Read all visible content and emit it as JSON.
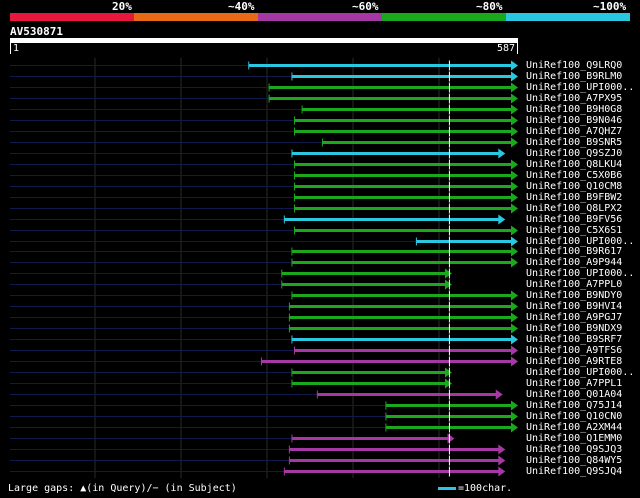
{
  "legend": [
    {
      "label": "",
      "color": "#e8173c"
    },
    {
      "label": "20%",
      "color": "#e86a17"
    },
    {
      "label": "~40%",
      "color": "#a638a6"
    },
    {
      "label": "~60%",
      "color": "#1ca81c"
    },
    {
      "label": "~80%",
      "color": "#29c7e0"
    },
    {
      "label": "~100%",
      "color": ""
    }
  ],
  "query": {
    "id": "AV530871",
    "start": "1",
    "end": "587"
  },
  "hits": [
    {
      "name": "UniRef100_Q9LRQ0",
      "color": "#29c7e0",
      "start": 0.47,
      "end": 1.0
    },
    {
      "name": "UniRef100_B9RLM0",
      "color": "#29c7e0",
      "start": 0.555,
      "end": 1.0
    },
    {
      "name": "UniRef100_UPI000..",
      "color": "#1ca81c",
      "start": 0.51,
      "end": 1.0
    },
    {
      "name": "UniRef100_A7PX95",
      "color": "#1ca81c",
      "start": 0.51,
      "end": 1.0
    },
    {
      "name": "UniRef100_B9H0G8",
      "color": "#1ca81c",
      "start": 0.575,
      "end": 1.0
    },
    {
      "name": "UniRef100_B9N046",
      "color": "#1ca81c",
      "start": 0.56,
      "end": 1.0
    },
    {
      "name": "UniRef100_A7QHZ7",
      "color": "#1ca81c",
      "start": 0.56,
      "end": 1.0
    },
    {
      "name": "UniRef100_B9SNR5",
      "color": "#1ca81c",
      "start": 0.615,
      "end": 1.0
    },
    {
      "name": "UniRef100_Q9SZJ0",
      "color": "#29c7e0",
      "start": 0.555,
      "end": 0.975
    },
    {
      "name": "UniRef100_Q8LKU4",
      "color": "#1ca81c",
      "start": 0.56,
      "end": 1.0
    },
    {
      "name": "UniRef100_C5X0B6",
      "color": "#1ca81c",
      "start": 0.56,
      "end": 1.0
    },
    {
      "name": "UniRef100_Q10CM8",
      "color": "#1ca81c",
      "start": 0.56,
      "end": 1.0
    },
    {
      "name": "UniRef100_B9FBW2",
      "color": "#1ca81c",
      "start": 0.56,
      "end": 1.0
    },
    {
      "name": "UniRef100_Q8LPX2",
      "color": "#1ca81c",
      "start": 0.56,
      "end": 1.0
    },
    {
      "name": "UniRef100_B9FV56",
      "color": "#29c7e0",
      "start": 0.54,
      "end": 0.975
    },
    {
      "name": "UniRef100_C5X6S1",
      "color": "#1ca81c",
      "start": 0.56,
      "end": 1.0
    },
    {
      "name": "UniRef100_UPI000..",
      "color": "#29c7e0",
      "start": 0.8,
      "end": 1.0
    },
    {
      "name": "UniRef100_B9R617",
      "color": "#1ca81c",
      "start": 0.555,
      "end": 1.0
    },
    {
      "name": "UniRef100_A9P944",
      "color": "#1ca81c",
      "start": 0.555,
      "end": 1.0
    },
    {
      "name": "UniRef100_UPI000..",
      "color": "#1ca81c",
      "start": 0.535,
      "end": 0.87
    },
    {
      "name": "UniRef100_A7PPL0",
      "color": "#1ca81c",
      "start": 0.535,
      "end": 0.87
    },
    {
      "name": "UniRef100_B9NDY0",
      "color": "#1ca81c",
      "start": 0.555,
      "end": 1.0
    },
    {
      "name": "UniRef100_B9HVI4",
      "color": "#1ca81c",
      "start": 0.55,
      "end": 1.0
    },
    {
      "name": "UniRef100_A9PGJ7",
      "color": "#1ca81c",
      "start": 0.55,
      "end": 1.0
    },
    {
      "name": "UniRef100_B9NDX9",
      "color": "#1ca81c",
      "start": 0.55,
      "end": 1.0
    },
    {
      "name": "UniRef100_B9SRF7",
      "color": "#29c7e0",
      "start": 0.555,
      "end": 1.0
    },
    {
      "name": "UniRef100_A9TFS6",
      "color": "#a638a6",
      "start": 0.56,
      "end": 1.0
    },
    {
      "name": "UniRef100_A9RTE8",
      "color": "#a638a6",
      "start": 0.495,
      "end": 1.0
    },
    {
      "name": "UniRef100_UPI000..",
      "color": "#1ca81c",
      "start": 0.555,
      "end": 0.87
    },
    {
      "name": "UniRef100_A7PPL1",
      "color": "#1ca81c",
      "start": 0.555,
      "end": 0.87
    },
    {
      "name": "UniRef100_Q01A04",
      "color": "#a638a6",
      "start": 0.605,
      "end": 0.97
    },
    {
      "name": "UniRef100_Q75J14",
      "color": "#1ca81c",
      "start": 0.74,
      "end": 1.0
    },
    {
      "name": "UniRef100_Q10CN0",
      "color": "#1ca81c",
      "start": 0.74,
      "end": 1.0
    },
    {
      "name": "UniRef100_A2XM44",
      "color": "#1ca81c",
      "start": 0.74,
      "end": 1.0
    },
    {
      "name": "UniRef100_Q1EMM0",
      "color": "#a638a6",
      "start": 0.555,
      "end": 0.875
    },
    {
      "name": "UniRef100_Q9SJQ3",
      "color": "#a638a6",
      "start": 0.55,
      "end": 0.975
    },
    {
      "name": "UniRef100_Q84WY5",
      "color": "#a638a6",
      "start": 0.55,
      "end": 0.975
    },
    {
      "name": "UniRef100_Q9SJQ4",
      "color": "#a638a6",
      "start": 0.54,
      "end": 0.975
    }
  ],
  "footer": {
    "gaps": "Large gaps: ▲(in Query)/− (in Subject)",
    "scale": "=100char."
  }
}
